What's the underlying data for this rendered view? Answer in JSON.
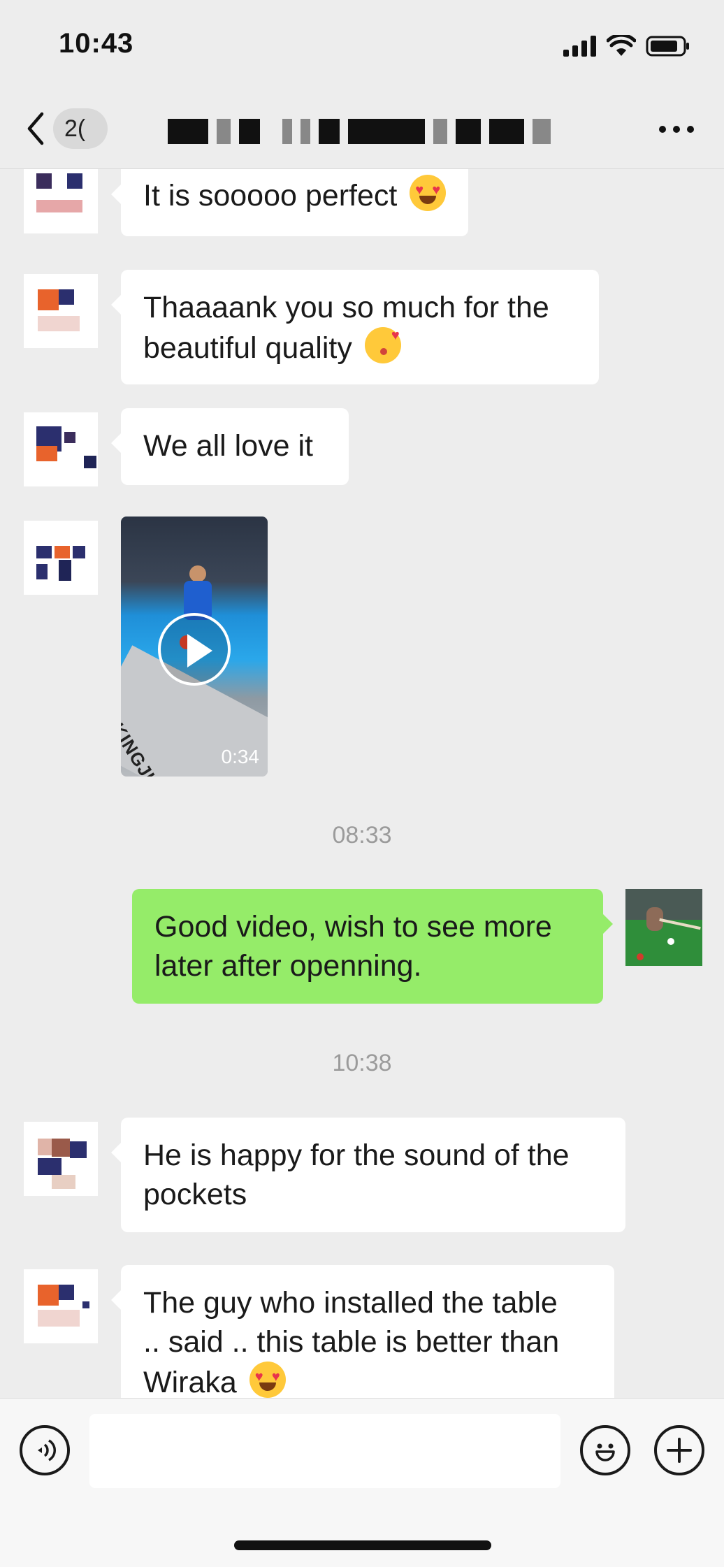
{
  "status_bar": {
    "time": "10:43"
  },
  "nav": {
    "back_badge": "2(",
    "more_label": "•••"
  },
  "messages": [
    {
      "text": "It is sooooo perfect",
      "emoji": "heart-eyes-emoji"
    },
    {
      "line1": "Thaaaank you so much for the",
      "line2": "beautiful quality",
      "emoji": "kiss-emoji"
    },
    {
      "text": "We all love it"
    },
    {
      "video_duration": "0:34",
      "video_brand": "KINGJUE"
    },
    {
      "timestamp": "08:33"
    },
    {
      "line1": "Good video, wish to see more",
      "line2": "later after openning."
    },
    {
      "timestamp": "10:38"
    },
    {
      "line1": "He is happy for the sound of the",
      "line2": "pockets"
    },
    {
      "line1": "The guy who installed the table",
      "line2": ".. said .. this table is better than",
      "line3": "Wiraka",
      "emoji": "heart-eyes-emoji"
    }
  ],
  "input": {
    "placeholder": ""
  },
  "colors": {
    "background": "#ededed",
    "outgoing_bubble": "#95ec69",
    "incoming_bubble": "#ffffff"
  }
}
